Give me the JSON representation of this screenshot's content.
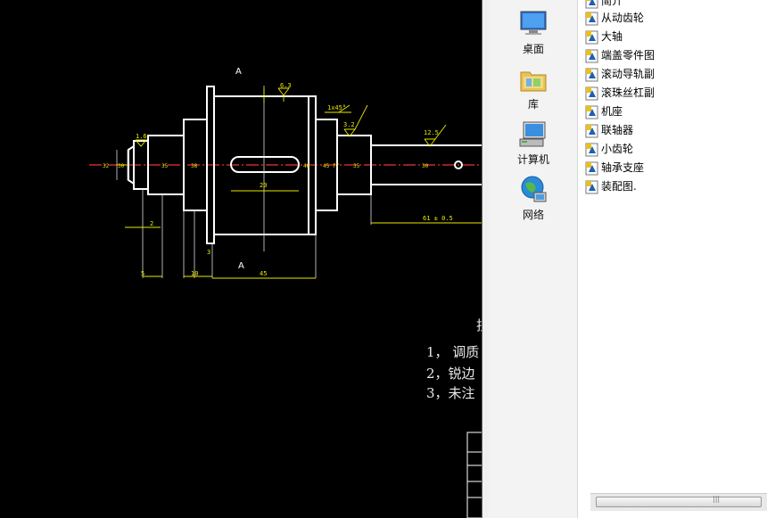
{
  "drawing": {
    "section_label_top": "A",
    "section_label_bottom": "A",
    "dims": {
      "d_6_3": "6.3",
      "d_1x45": "1x45°",
      "d_3_2": "3.2",
      "d_12_5": "12.5",
      "d_1_6": "1.6",
      "d_61": "61 ± 0.5",
      "d_20": "20",
      "d_45": "45",
      "d_10": "10",
      "d_3": "3",
      "d_2": "2",
      "d_5": "5"
    },
    "notes": [
      "技",
      "1，  调质",
      "2，锐边",
      "3，未注"
    ]
  },
  "navigation": {
    "items": [
      {
        "label": "桌面"
      },
      {
        "label": "库"
      },
      {
        "label": "计算机"
      },
      {
        "label": "网络"
      }
    ]
  },
  "files": {
    "items": [
      {
        "name": "简介"
      },
      {
        "name": "从动齿轮"
      },
      {
        "name": "大轴"
      },
      {
        "name": "端盖零件图"
      },
      {
        "name": "滚动导轨副"
      },
      {
        "name": "滚珠丝杠副"
      },
      {
        "name": "机座"
      },
      {
        "name": "联轴器"
      },
      {
        "name": "小齿轮"
      },
      {
        "name": "轴承支座"
      },
      {
        "name": "装配图."
      }
    ]
  },
  "scrollbar": {
    "grip": "|||"
  }
}
